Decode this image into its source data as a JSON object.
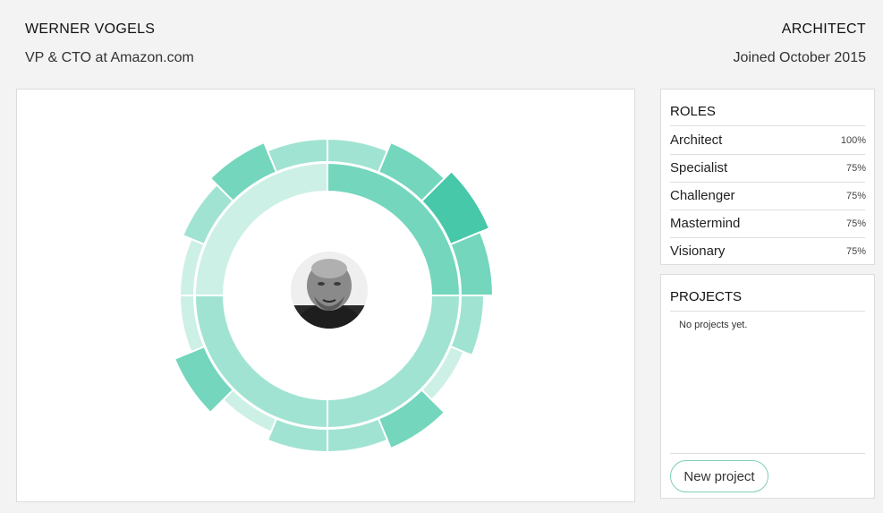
{
  "profile": {
    "name": "WERNER VOGELS",
    "title": "VP & CTO at Amazon.com",
    "primary_role": "ARCHITECT",
    "joined": "Joined October 2015"
  },
  "roles": {
    "heading": "ROLES",
    "items": [
      {
        "name": "Architect",
        "percent": "100%"
      },
      {
        "name": "Specialist",
        "percent": "75%"
      },
      {
        "name": "Challenger",
        "percent": "75%"
      },
      {
        "name": "Mastermind",
        "percent": "75%"
      },
      {
        "name": "Visionary",
        "percent": "75%"
      }
    ]
  },
  "projects": {
    "heading": "PROJECTS",
    "empty_text": "No projects yet.",
    "new_button": "New project"
  },
  "colors": {
    "c1": "#cdf0e6",
    "c2": "#a1e3d2",
    "c3": "#73d6bd",
    "c4": "#46c8a9"
  },
  "chart": {
    "inner_ring": [
      3,
      2,
      2,
      1
    ],
    "outer_ring": [
      2,
      3,
      4,
      3,
      2,
      1,
      3,
      2,
      2,
      1,
      3,
      1,
      1,
      2,
      3,
      2
    ]
  }
}
